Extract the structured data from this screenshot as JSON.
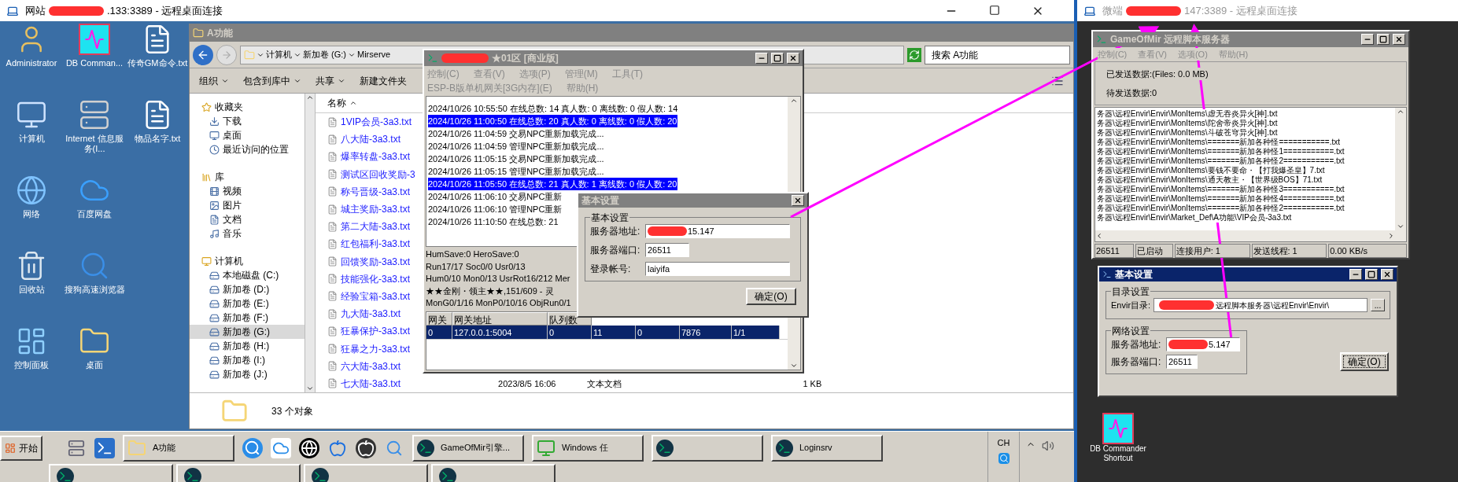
{
  "left_session": {
    "title_prefix": "网站",
    "title_redacted": true,
    "title": ".133:3389 - 远程桌面连接",
    "desktop_columns": [
      [
        {
          "label": "Administrator",
          "kind": "user"
        },
        {
          "label": "计算机",
          "kind": "computer"
        },
        {
          "label": "网络",
          "kind": "network"
        },
        {
          "label": "回收站",
          "kind": "recycle"
        },
        {
          "label": "控制面板",
          "kind": "control"
        }
      ],
      [
        {
          "label": "DB Comman...",
          "kind": "dbc"
        },
        {
          "label": "Internet 信息服务(I...",
          "kind": "server"
        },
        {
          "label": "百度网盘",
          "kind": "cloud"
        },
        {
          "label": "搜狗高速浏览器",
          "kind": "browser"
        },
        {
          "label": "桌面",
          "kind": "folder"
        }
      ],
      [
        {
          "label": "传奇GM命令.txt",
          "kind": "document"
        },
        {
          "label": "物品名字.txt",
          "kind": "document"
        }
      ]
    ],
    "explorer": {
      "title": "A功能",
      "breadcrumb": [
        "计算机",
        "新加卷 (G:)",
        "Mirserve"
      ],
      "search": {
        "placeholder": "搜索 A功能"
      },
      "toolbar": [
        "组织",
        "包含到库中",
        "共享",
        "新建文件夹"
      ],
      "sidebar": [
        {
          "label": "收藏夹",
          "kind": "star",
          "children": [
            {
              "label": "下载",
              "kind": "download",
              "selected": false
            },
            {
              "label": "桌面",
              "kind": "desktop",
              "selected": false
            },
            {
              "label": "最近访问的位置",
              "kind": "recent",
              "selected": false
            }
          ]
        },
        {
          "label": "库",
          "kind": "library",
          "children": [
            {
              "label": "视频",
              "kind": "video",
              "selected": false
            },
            {
              "label": "图片",
              "kind": "picture",
              "selected": false
            },
            {
              "label": "文档",
              "kind": "doc",
              "selected": false
            },
            {
              "label": "音乐",
              "kind": "music",
              "selected": false
            }
          ]
        },
        {
          "label": "计算机",
          "kind": "computer",
          "children": [
            {
              "label": "本地磁盘 (C:)",
              "kind": "drive",
              "selected": false
            },
            {
              "label": "新加卷 (D:)",
              "kind": "drive",
              "selected": false
            },
            {
              "label": "新加卷 (E:)",
              "kind": "drive",
              "selected": false
            },
            {
              "label": "新加卷 (F:)",
              "kind": "drive",
              "selected": false
            },
            {
              "label": "新加卷 (G:)",
              "kind": "drive",
              "selected": true
            },
            {
              "label": "新加卷 (H:)",
              "kind": "drive",
              "selected": false
            },
            {
              "label": "新加卷 (I:)",
              "kind": "drive",
              "selected": false
            },
            {
              "label": "新加卷 (J:)",
              "kind": "drive",
              "selected": false
            }
          ]
        }
      ],
      "column": "名称",
      "files": [
        "1VIP会员-3a3.txt",
        "八大陆-3a3.txt",
        "爆率转盘-3a3.txt",
        "测试区回收奖励-3",
        "称号晋级-3a3.txt",
        "城主奖励-3a3.txt",
        "第二大陆-3a3.txt",
        "红包福利-3a3.txt",
        "回馈奖励-3a3.txt",
        "技能强化-3a3.txt",
        "经验宝箱-3a3.txt",
        "九大陆-3a3.txt",
        "狂暴保护-3a3.txt",
        "狂暴之力-3a3.txt",
        "六大陆-3a3.txt",
        "七大陆-3a3.txt"
      ],
      "last_file_details": [
        "2023/8/5 16:06",
        "文本文档",
        "1 KB"
      ],
      "status": "33 个对象"
    },
    "mir_window": {
      "title_redacted": true,
      "title": "★01区 [商业版]",
      "menu": [
        "控制(C)",
        "查看(V)",
        "选项(P)",
        "管理(M)",
        "工具(T)",
        "ESP-B版单机网关[3G内存](E)",
        "帮助(H)"
      ],
      "log": [
        {
          "text": "2024/10/26 10:55:50 在线总数: 14 真人数: 0 离线数: 0 假人数: 14",
          "highlighted": false
        },
        {
          "text": "2024/10/26 11:00:50 在线总数: 20 真人数: 0 离线数: 0 假人数: 20",
          "highlighted": true
        },
        {
          "text": "2024/10/26 11:04:59 交易NPC重新加载完成...",
          "highlighted": false
        },
        {
          "text": "2024/10/26 11:04:59 管理NPC重新加载完成...",
          "highlighted": false
        },
        {
          "text": "2024/10/26 11:05:15 交易NPC重新加载完成...",
          "highlighted": false
        },
        {
          "text": "2024/10/26 11:05:15 管理NPC重新加载完成...",
          "highlighted": false
        },
        {
          "text": "2024/10/26 11:05:50 在线总数: 21 真人数: 1 离线数: 0 假人数: 20",
          "highlighted": true
        },
        {
          "text": "2024/10/26 11:06:10 交易NPC重新",
          "highlighted": false
        },
        {
          "text": "2024/10/26 11:06:10 管理NPC重新",
          "highlighted": false
        },
        {
          "text": "2024/10/26 11:10:50 在线总数: 21",
          "highlighted": false
        }
      ],
      "stats": [
        "HumSave:0 HeroSave:0",
        "Run17/17 Soc0/0 Usr0/13",
        "Hum0/10 Mon0/13 UsrRot16/212 Mer",
        "★★金刚・领主★★,151/609 - 灵",
        "MonG0/1/16 MonP0/10/16 ObjRun0/1"
      ],
      "grid": {
        "columns": [
          "网关",
          "网关地址",
          "队列数"
        ],
        "rows": [
          {
            "cells": [
              "0",
              "127.0.0.1:5004",
              "0",
              "11",
              "0",
              "7876",
              "1/1"
            ],
            "selected": true
          }
        ]
      }
    },
    "settings_dialog": {
      "title": "基本设置",
      "group": "基本设置",
      "fields": [
        {
          "label": "服务器地址:",
          "value": "15.147",
          "redacted": true
        },
        {
          "label": "服务器端口:",
          "value": "26511",
          "redacted": false
        },
        {
          "label": "登录帐号:",
          "value": "laiyifa",
          "redacted": false
        }
      ],
      "ok": "确定(O)"
    },
    "taskbar": {
      "start": "开始",
      "items": [
        {
          "kind": "server"
        },
        {
          "kind": "powershell"
        },
        {
          "kind": "folder-button",
          "label": "A功能"
        },
        {
          "kind": "sogou"
        },
        {
          "kind": "cloud"
        },
        {
          "kind": "yinyang"
        },
        {
          "kind": "apple"
        },
        {
          "kind": "apple-dark"
        },
        {
          "kind": "magnifier"
        },
        {
          "kind": "app-button",
          "label": "GameOfMir引擎..."
        },
        {
          "kind": "monitor-button",
          "label": "Windows 任"
        },
        {
          "kind": "app-button"
        },
        {
          "kind": "app-button",
          "label": "Loginsrv"
        }
      ],
      "language": "CH"
    }
  },
  "right_session": {
    "title_prefix": "微端",
    "title_redacted": true,
    "title": "147:3389 - 远程桌面连接",
    "server_window": {
      "title": "GameOfMir 远程脚本服务器",
      "menu": [
        "控制(C)",
        "查看(V)",
        "选项(O)",
        "帮助(H)"
      ],
      "sent": "已发送数据:(Files: 0.0 MB)",
      "pending": "待发送数据:0",
      "log": [
        "务器\\远程Envir\\Envir\\MonItems\\虚无吞炎异火[神].txt",
        "务器\\远程Envir\\Envir\\MonItems\\陀舍帝炎异火[神].txt",
        "务器\\远程Envir\\Envir\\MonItems\\斗破苍穹异火[神].txt",
        "务器\\远程Envir\\Envir\\MonItems\\=======新加各种怪===========.txt",
        "务器\\远程Envir\\Envir\\MonItems\\=======新加各种怪1===========.txt",
        "务器\\远程Envir\\Envir\\MonItems\\=======新加各种怪2===========.txt",
        "务器\\远程Envir\\Envir\\MonItems\\要钱不要命・【打我爆圣皇】7.txt",
        "务器\\远程Envir\\Envir\\MonItems\\通天教主・【世界级BOS】71.txt",
        "务器\\远程Envir\\Envir\\MonItems\\=======新加各种怪3===========.txt",
        "务器\\远程Envir\\Envir\\MonItems\\=======新加各种怪4===========.txt",
        "务器\\远程Envir\\Envir\\MonItems\\=======新加各种怪2===========.txt",
        "务器\\远程Envir\\Envir\\Market_Def\\A功能\\VIP会员-3a3.txt"
      ],
      "status": [
        "26511",
        "已启动",
        "连接用户: 1",
        "发送线程: 1",
        "0.00 KB/s"
      ]
    },
    "settings_dialog": {
      "title": "基本设置",
      "dir_group": "目录设置",
      "dir_label": "Envir目录:",
      "dir_value": "远程脚本服务器\\远程Envir\\Envir\\",
      "dir_redacted": true,
      "browse": "...",
      "net_group": "网络设置",
      "fields": [
        {
          "label": "服务器地址:",
          "value": "5.147",
          "redacted": true
        },
        {
          "label": "服务器端口:",
          "value": "26511",
          "redacted": false
        }
      ],
      "ok": "确定(O)"
    },
    "desktop_icon": {
      "label": "DB Commander Shortcut",
      "kind": "dbc"
    }
  }
}
